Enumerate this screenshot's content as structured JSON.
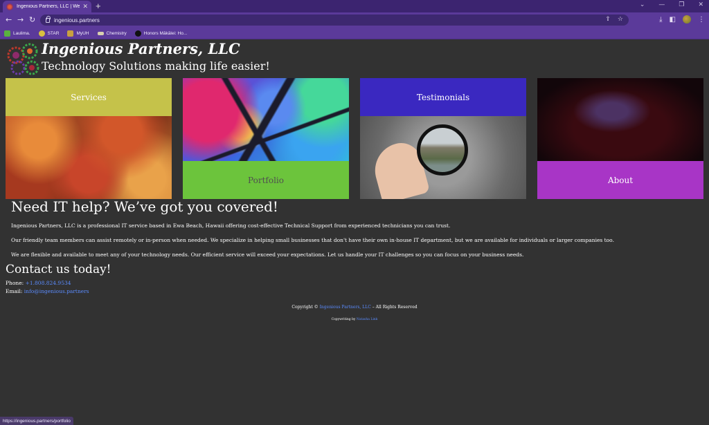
{
  "browser": {
    "tab_title": "Ingenious Partners, LLC | Welcome",
    "url": "ingenious.partners",
    "status_url": "https://ingenious.partners/portfolio",
    "bookmarks": [
      "Laulima.",
      "STAR",
      "MyUH",
      "Chemistry",
      "Honors Mākālei: Ho..."
    ],
    "colors": {
      "frame": "#3c2470",
      "toolbar": "#5b3a9a"
    }
  },
  "header": {
    "title": "Ingenious Partners, LLC",
    "tagline": "Technology Solutions making life easier!"
  },
  "tiles": {
    "services": "Services",
    "portfolio": "Portfolio",
    "testimonials": "Testimonials",
    "about": "About"
  },
  "intro": {
    "heading": "Need IT help? We’ve got you covered!",
    "p1": "Ingenious Partners, LLC is a professional IT service based in Ewa Beach, Hawaii offering cost-effective Technical Support from experienced technicians you can trust.",
    "p2": "Our friendly team members can assist remotely or in-person when needed. We specialize in helping small businesses that don't have their own in-house IT department, but we are available for individuals or larger companies too.",
    "p3": "We are flexible and available to meet any of your technology needs. Our efficient service will exceed your expectations. Let us handle your IT challenges so you can focus on your business needs."
  },
  "contact": {
    "heading": "Contact us today!",
    "phone_label": "Phone:",
    "phone": "+1.808.824.9534",
    "email_label": "Email:",
    "email": "info@ingenious.partners"
  },
  "footer": {
    "copyright_prefix": "Copyright ©",
    "company_link": "Ingenious Partners, LLC",
    "rights": "– All Rights Reserved",
    "credit_prefix": "Copywriting by",
    "credit_name": "Natasha Link"
  },
  "tile_colors": {
    "services": "#c5c24a",
    "portfolio": "#6cc43c",
    "testimonials": "#3a28c0",
    "about": "#a835c6"
  }
}
